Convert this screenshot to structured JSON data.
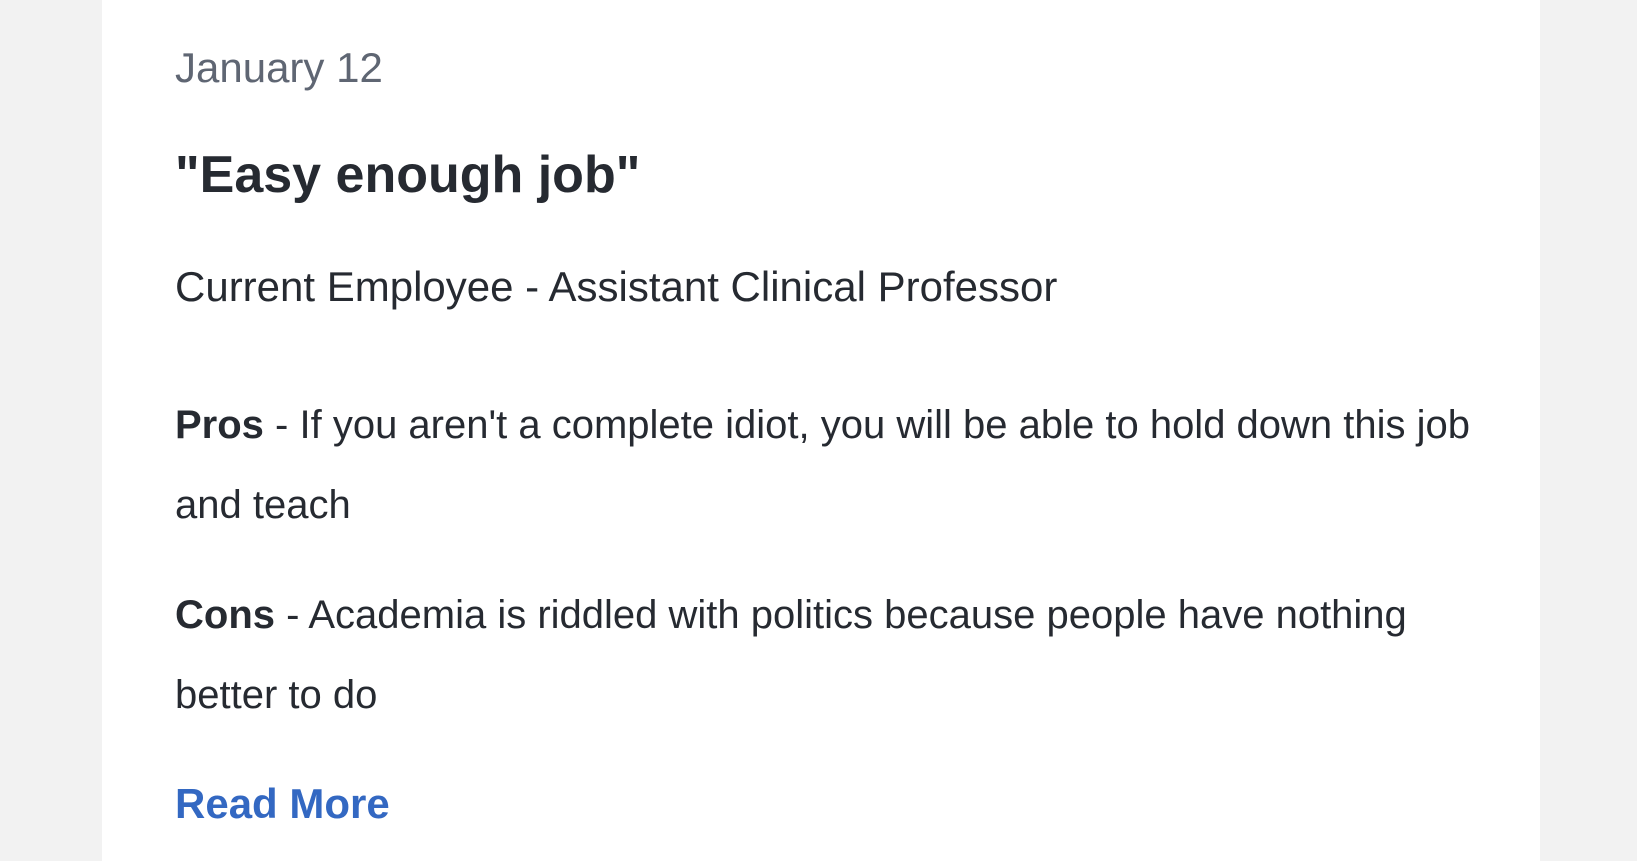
{
  "review": {
    "date": "January 12",
    "title": "\"Easy enough job\"",
    "role": "Current Employee - Assistant Clinical Professor",
    "pros": {
      "label": "Pros",
      "separator": " - ",
      "text": "If you aren't a complete idiot, you will be able to hold down this job and teach"
    },
    "cons": {
      "label": "Cons",
      "separator": " - ",
      "text": "Academia is riddled with politics because people have nothing better to do"
    },
    "read_more_label": "Read More"
  },
  "colors": {
    "link": "#3368c2",
    "text": "#262a31",
    "muted": "#5f6673",
    "page_background": "#f2f2f2",
    "card_background": "#ffffff"
  }
}
